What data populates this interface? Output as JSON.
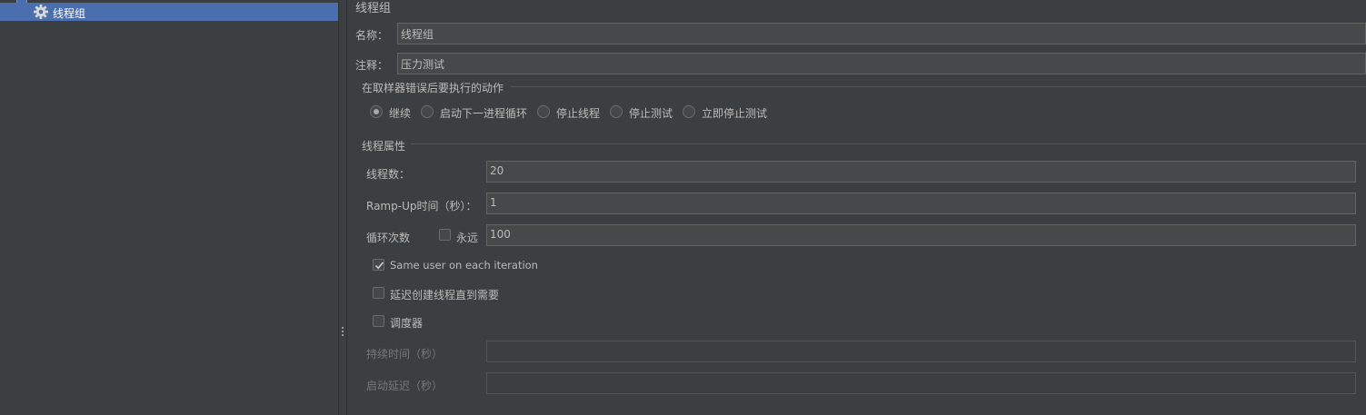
{
  "tree": {
    "selected_item": {
      "label": "线程组",
      "icon": "gear-icon"
    }
  },
  "form": {
    "title": "线程组",
    "name": {
      "label": "名称：",
      "value": "线程组"
    },
    "comment": {
      "label": "注释：",
      "value": "压力测试"
    },
    "sampler_error": {
      "section_label": "在取样器错误后要执行的动作",
      "options": [
        "继续",
        "启动下一进程循环",
        "停止线程",
        "停止测试",
        "立即停止测试"
      ],
      "selected": "继续"
    },
    "thread_props": {
      "section_label": "线程属性",
      "threads": {
        "label": "线程数：",
        "value": "20"
      },
      "rampup": {
        "label": "Ramp-Up时间（秒）：",
        "value": "1"
      },
      "loops": {
        "label": "循环次数",
        "forever_label": "永远",
        "forever_checked": false,
        "value": "100"
      },
      "same_user": {
        "label": "Same user on each iteration",
        "checked": true
      },
      "delay_create": {
        "label": "延迟创建线程直到需要",
        "checked": false
      },
      "scheduler": {
        "label": "调度器",
        "checked": false
      },
      "duration": {
        "label": "持续时间（秒）",
        "value": ""
      },
      "startup_delay": {
        "label": "启动延迟（秒）",
        "value": ""
      }
    }
  },
  "colors": {
    "background": "#3c3f41",
    "selection": "#4b6eaf",
    "field_bg": "#45494a",
    "text": "#bbbbbb",
    "disabled_text": "#777777"
  }
}
